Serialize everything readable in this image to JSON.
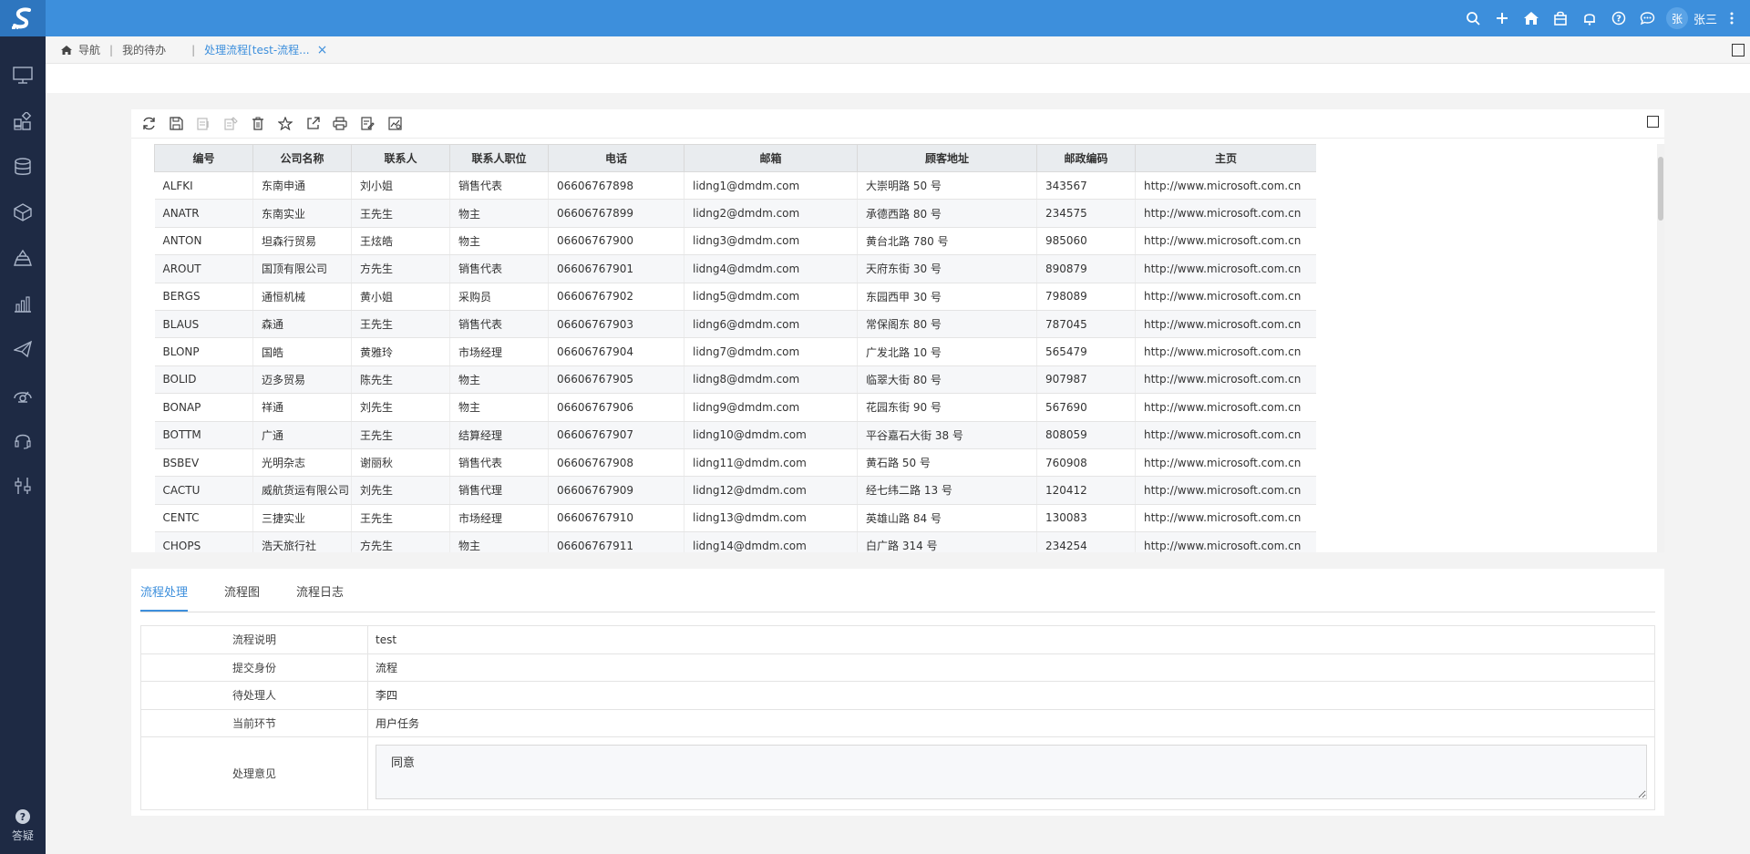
{
  "header": {
    "logo_letter": "S",
    "user_avatar": "张",
    "user_name": "张三",
    "icons": [
      "search-icon",
      "plus-icon",
      "home-icon",
      "bag-icon",
      "bell-icon",
      "help-icon",
      "chat-icon",
      "more-icon"
    ]
  },
  "sidebar": {
    "items": [
      "monitor-icon",
      "apps-icon",
      "database-icon",
      "cube-icon",
      "layers-icon",
      "chart-icon",
      "send-icon",
      "gauge-icon",
      "headset-icon",
      "tools-icon"
    ],
    "bottom_label": "答疑"
  },
  "breadcrumb": {
    "home_label": "导航",
    "todo_label": "我的待办",
    "active_tab": "处理流程[test-流程..."
  },
  "grid": {
    "columns": [
      "编号",
      "公司名称",
      "联系人",
      "联系人职位",
      "电话",
      "邮箱",
      "顾客地址",
      "邮政编码",
      "主页"
    ],
    "rows": [
      [
        "ALFKI",
        "东南申通",
        "刘小姐",
        "销售代表",
        "06606767898",
        "lidng1@dmdm.com",
        "大崇明路 50 号",
        "343567",
        "http://www.microsoft.com.cn"
      ],
      [
        "ANATR",
        "东南实业",
        "王先生",
        "物主",
        "06606767899",
        "lidng2@dmdm.com",
        "承德西路 80 号",
        "234575",
        "http://www.microsoft.com.cn"
      ],
      [
        "ANTON",
        "坦森行贸易",
        "王炫皓",
        "物主",
        "06606767900",
        "lidng3@dmdm.com",
        "黄台北路 780 号",
        "985060",
        "http://www.microsoft.com.cn"
      ],
      [
        "AROUT",
        "国顶有限公司",
        "方先生",
        "销售代表",
        "06606767901",
        "lidng4@dmdm.com",
        "天府东街 30 号",
        "890879",
        "http://www.microsoft.com.cn"
      ],
      [
        "BERGS",
        "通恒机械",
        "黄小姐",
        "采购员",
        "06606767902",
        "lidng5@dmdm.com",
        "东园西甲 30 号",
        "798089",
        "http://www.microsoft.com.cn"
      ],
      [
        "BLAUS",
        "森通",
        "王先生",
        "销售代表",
        "06606767903",
        "lidng6@dmdm.com",
        "常保阁东 80 号",
        "787045",
        "http://www.microsoft.com.cn"
      ],
      [
        "BLONP",
        "国皓",
        "黄雅玲",
        "市场经理",
        "06606767904",
        "lidng7@dmdm.com",
        "广发北路 10 号",
        "565479",
        "http://www.microsoft.com.cn"
      ],
      [
        "BOLID",
        "迈多贸易",
        "陈先生",
        "物主",
        "06606767905",
        "lidng8@dmdm.com",
        "临翠大街 80 号",
        "907987",
        "http://www.microsoft.com.cn"
      ],
      [
        "BONAP",
        "祥通",
        "刘先生",
        "物主",
        "06606767906",
        "lidng9@dmdm.com",
        "花园东街 90 号",
        "567690",
        "http://www.microsoft.com.cn"
      ],
      [
        "BOTTM",
        "广通",
        "王先生",
        "结算经理",
        "06606767907",
        "lidng10@dmdm.com",
        "平谷嘉石大街 38 号",
        "808059",
        "http://www.microsoft.com.cn"
      ],
      [
        "BSBEV",
        "光明杂志",
        "谢丽秋",
        "销售代表",
        "06606767908",
        "lidng11@dmdm.com",
        "黄石路 50 号",
        "760908",
        "http://www.microsoft.com.cn"
      ],
      [
        "CACTU",
        "威航货运有限公司",
        "刘先生",
        "销售代理",
        "06606767909",
        "lidng12@dmdm.com",
        "经七纬二路 13 号",
        "120412",
        "http://www.microsoft.com.cn"
      ],
      [
        "CENTC",
        "三捷实业",
        "王先生",
        "市场经理",
        "06606767910",
        "lidng13@dmdm.com",
        "英雄山路 84 号",
        "130083",
        "http://www.microsoft.com.cn"
      ],
      [
        "CHOPS",
        "浩天旅行社",
        "方先生",
        "物主",
        "06606767911",
        "lidng14@dmdm.com",
        "白广路 314 号",
        "234254",
        "http://www.microsoft.com.cn"
      ]
    ]
  },
  "process": {
    "tabs": [
      "流程处理",
      "流程图",
      "流程日志"
    ],
    "fields": [
      {
        "label": "流程说明",
        "value": "test"
      },
      {
        "label": "提交身份",
        "value": "流程"
      },
      {
        "label": "待处理人",
        "value": "李四"
      },
      {
        "label": "当前环节",
        "value": "用户任务"
      }
    ],
    "opinion_label": "处理意见",
    "opinion_value": "同意"
  }
}
